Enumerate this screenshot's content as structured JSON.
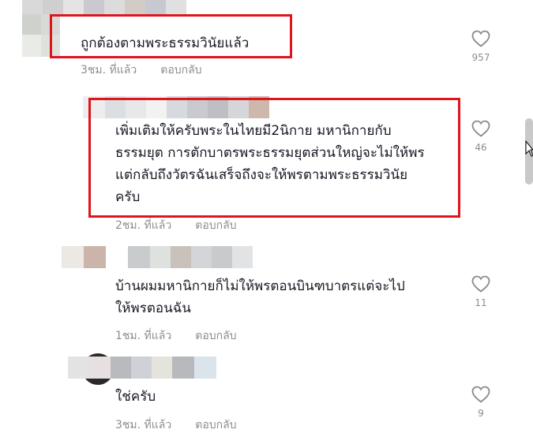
{
  "comments": [
    {
      "text_lines": [
        "ถูกต้องตามพระธรรมวินัยแล้ว"
      ],
      "time": "3ชม. ที่แล้ว",
      "reply": "ตอบกลับ",
      "likes": "957"
    },
    {
      "text_lines": [
        "เพิ่มเติมให้ครับพระในไทยมี2นิกาย มหานิกายกับ",
        "ธรรมยุต การตักบาตรพระธรรมยุตส่วนใหญ่จะไม่ให้พร",
        "แต่กลับถึงวัตรฉันเสร็จถึงจะให้พรตามพระธรรมวินัย",
        "ครับ"
      ],
      "time": "2ชม. ที่แล้ว",
      "reply": "ตอบกลับ",
      "likes": "46"
    },
    {
      "text_lines": [
        "บ้านผมมหานิกายก็ไม่ให้พรตอนบินฑบาตรแต่จะไป",
        "ให้พรตอนฉัน"
      ],
      "time": "1ชม. ที่แล้ว",
      "reply": "ตอบกลับ",
      "likes": "11"
    },
    {
      "text_lines": [
        "ใช่ครับ"
      ],
      "time": "3ชม. ที่แล้ว",
      "reply": "ตอบกลับ",
      "likes": "9"
    }
  ],
  "colors": {
    "highlight": "#e0141e",
    "text": "#161823",
    "muted": "rgba(22,24,35,0.5)"
  },
  "icons": [
    "heart-outline-icon",
    "mouse-cursor-icon"
  ]
}
